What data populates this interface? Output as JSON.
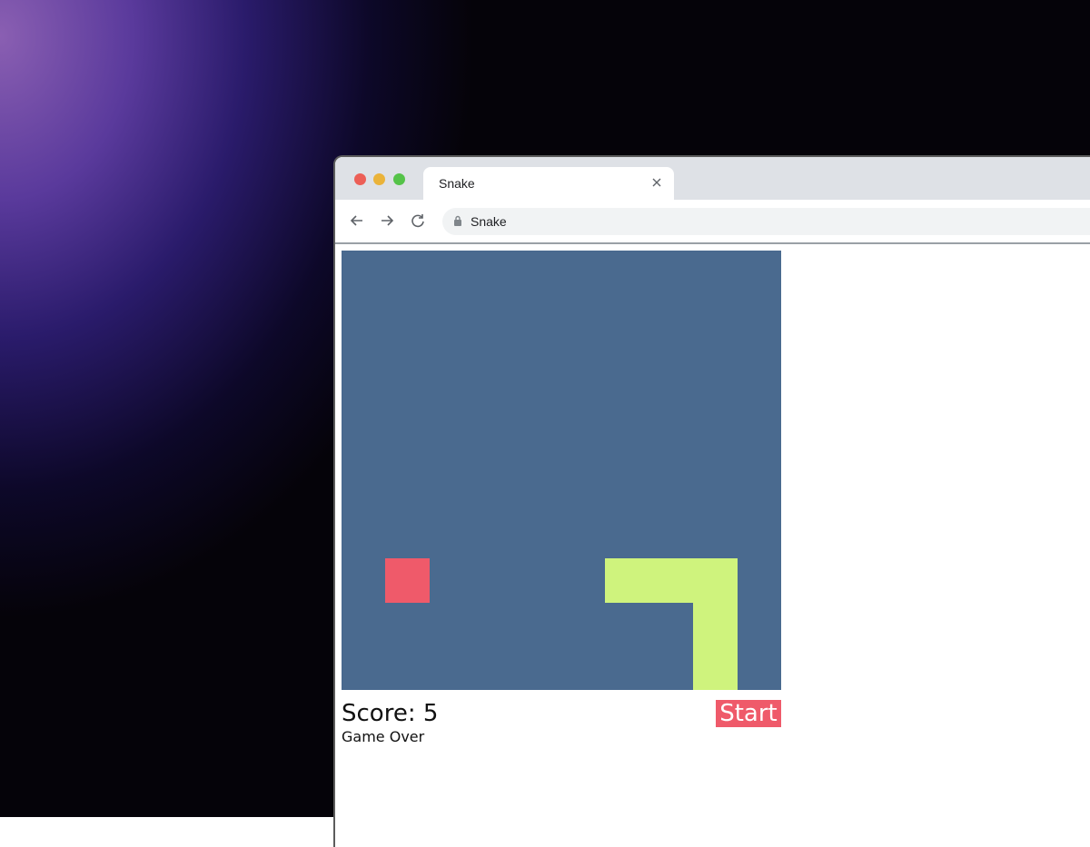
{
  "browser": {
    "tab_title": "Snake",
    "tab_close_icon": "close-icon",
    "url": "Snake",
    "nav_icons": [
      "back-arrow-icon",
      "forward-arrow-icon",
      "reload-icon"
    ],
    "lock_icon": "lock-icon",
    "traffic_lights": {
      "close": "#ec5f57",
      "minimize": "#eab33a",
      "zoom": "#55c349"
    }
  },
  "game": {
    "grid_size": 10,
    "colors": {
      "board": "#4a6a8f",
      "food": "#ef5a6a",
      "snake": "#cff37d",
      "button": "#ef5a6a"
    },
    "food": [
      1,
      7
    ],
    "snake": [
      [
        6,
        7
      ],
      [
        7,
        7
      ],
      [
        8,
        7
      ],
      [
        8,
        8
      ],
      [
        8,
        9
      ]
    ],
    "score_text": "Score: 5",
    "status_text": "Game Over",
    "start_label": "Start"
  }
}
